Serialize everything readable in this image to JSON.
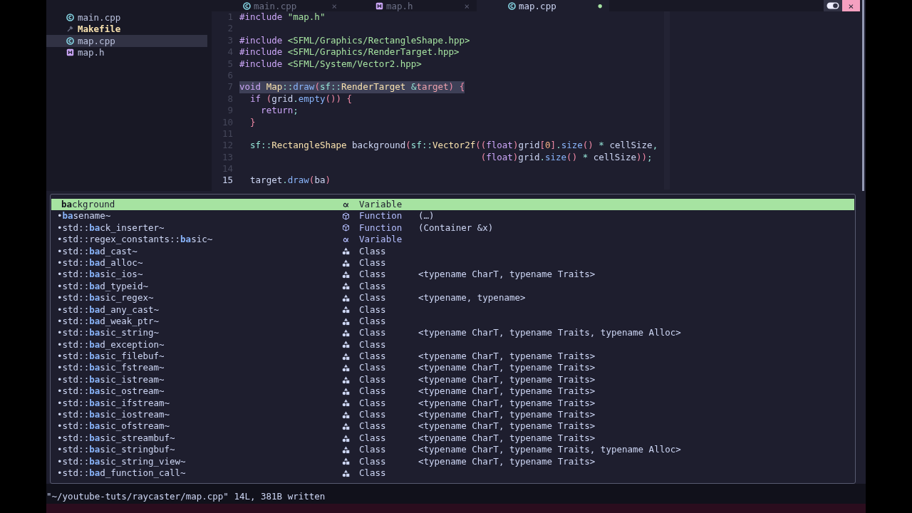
{
  "sidebar": {
    "files": [
      {
        "name": "main.cpp",
        "kind": "cpp",
        "selected": false,
        "modified": false
      },
      {
        "name": "Makefile",
        "kind": "make",
        "selected": false,
        "modified": true
      },
      {
        "name": "map.cpp",
        "kind": "cpp",
        "selected": true,
        "modified": false
      },
      {
        "name": "map.h",
        "kind": "header",
        "selected": false,
        "modified": false
      }
    ]
  },
  "tabs": [
    {
      "label": "main.cpp",
      "kind": "cpp",
      "selected": false,
      "close": "×"
    },
    {
      "label": "map.h",
      "kind": "header",
      "selected": false,
      "close": "×"
    },
    {
      "label": "map.cpp",
      "kind": "cpp",
      "selected": true,
      "close": "●"
    }
  ],
  "window": {
    "close": "×"
  },
  "editor": {
    "lines": [
      {
        "number": "1",
        "current": false,
        "tokens": [
          {
            "kind": "kw",
            "text": "#include"
          },
          {
            "kind": "str",
            "text": " \"map.h\""
          }
        ]
      },
      {
        "number": "2",
        "current": false
      },
      {
        "number": "3",
        "current": false,
        "tokens": [
          {
            "kind": "kw",
            "text": "#include"
          },
          {
            "kind": "str",
            "text": " <SFML/Graphics/RectangleShape.hpp>"
          }
        ]
      },
      {
        "number": "4",
        "current": false,
        "tokens": [
          {
            "kind": "kw",
            "text": "#include"
          },
          {
            "kind": "str",
            "text": " <SFML/Graphics/RenderTarget.hpp>"
          }
        ]
      },
      {
        "number": "5",
        "current": false,
        "tokens": [
          {
            "kind": "kw",
            "text": "#include"
          },
          {
            "kind": "str",
            "text": " <SFML/System/Vector2.hpp>"
          }
        ]
      },
      {
        "number": "6",
        "current": false
      },
      {
        "number": "7",
        "current": false,
        "highlighted": true,
        "tokens": [
          {
            "kind": "kw",
            "text": "void"
          },
          {
            "kind": "type",
            "text": " Map"
          },
          {
            "kind": "op",
            "text": "::"
          },
          {
            "kind": "fn",
            "text": "draw"
          },
          {
            "kind": "punct",
            "text": "("
          },
          {
            "kind": "ns",
            "text": "sf"
          },
          {
            "kind": "op",
            "text": "::"
          },
          {
            "kind": "type",
            "text": "RenderTarget"
          },
          {
            "kind": "op",
            "text": " &"
          },
          {
            "kind": "param",
            "text": "target"
          },
          {
            "kind": "punct",
            "text": ")"
          },
          {
            "kind": "punct",
            "text": " {"
          }
        ]
      },
      {
        "number": "8",
        "current": false,
        "tokens": [
          {
            "kind": "kw",
            "text": "  if"
          },
          {
            "kind": "punct",
            "text": " ("
          },
          {
            "kind": "var",
            "text": "grid"
          },
          {
            "kind": "op",
            "text": "."
          },
          {
            "kind": "fn",
            "text": "empty"
          },
          {
            "kind": "punct",
            "text": "())"
          },
          {
            "kind": "punct",
            "text": " {"
          }
        ]
      },
      {
        "number": "9",
        "current": false,
        "tokens": [
          {
            "kind": "kw",
            "text": "    return"
          },
          {
            "kind": "op",
            "text": ";"
          }
        ]
      },
      {
        "number": "10",
        "current": false,
        "tokens": [
          {
            "kind": "punct",
            "text": "  }"
          }
        ]
      },
      {
        "number": "11",
        "current": false
      },
      {
        "number": "12",
        "current": false,
        "tokens": [
          {
            "kind": "ns",
            "text": "  sf"
          },
          {
            "kind": "op",
            "text": "::"
          },
          {
            "kind": "type",
            "text": "RectangleShape"
          },
          {
            "kind": "var",
            "text": " background"
          },
          {
            "kind": "punct",
            "text": "("
          },
          {
            "kind": "ns",
            "text": "sf"
          },
          {
            "kind": "op",
            "text": "::"
          },
          {
            "kind": "type",
            "text": "Vector2f"
          },
          {
            "kind": "punct",
            "text": "(("
          },
          {
            "kind": "kw",
            "text": "float"
          },
          {
            "kind": "punct",
            "text": ")"
          },
          {
            "kind": "var",
            "text": "grid"
          },
          {
            "kind": "punct",
            "text": "["
          },
          {
            "kind": "num",
            "text": "0"
          },
          {
            "kind": "punct",
            "text": "]"
          },
          {
            "kind": "op",
            "text": "."
          },
          {
            "kind": "fn",
            "text": "size"
          },
          {
            "kind": "punct",
            "text": "()"
          },
          {
            "kind": "op",
            "text": " *"
          },
          {
            "kind": "var",
            "text": " cellSize"
          },
          {
            "kind": "op",
            "text": ","
          }
        ]
      },
      {
        "number": "13",
        "current": false,
        "tokens": [
          {
            "kind": "punct",
            "text": "                                             ("
          },
          {
            "kind": "kw",
            "text": "float"
          },
          {
            "kind": "punct",
            "text": ")"
          },
          {
            "kind": "var",
            "text": "grid"
          },
          {
            "kind": "op",
            "text": "."
          },
          {
            "kind": "fn",
            "text": "size"
          },
          {
            "kind": "punct",
            "text": "()"
          },
          {
            "kind": "op",
            "text": " *"
          },
          {
            "kind": "var",
            "text": " cellSize"
          },
          {
            "kind": "punct",
            "text": "))"
          },
          {
            "kind": "op",
            "text": ";"
          }
        ]
      },
      {
        "number": "14",
        "current": false
      },
      {
        "number": "15",
        "current": true,
        "tokens": [
          {
            "kind": "var",
            "text": "  target"
          },
          {
            "kind": "op",
            "text": "."
          },
          {
            "kind": "fn",
            "text": "draw"
          },
          {
            "kind": "punct",
            "text": "("
          },
          {
            "kind": "var",
            "text": "ba"
          },
          {
            "kind": "punct",
            "text": ")"
          }
        ]
      }
    ]
  },
  "completion": {
    "items": [
      {
        "match": "ba",
        "after": "ckground",
        "kind": "variable",
        "kind_label": "Variable",
        "selected": true
      },
      {
        "before": "•",
        "match": "ba",
        "after": "sename~",
        "kind": "function",
        "kind_label": "Function",
        "detail": "(…)",
        "selected": false
      },
      {
        "before": "•std::",
        "match": "ba",
        "after": "ck_inserter~",
        "kind": "function",
        "kind_label": "Function",
        "detail": "(Container &x)",
        "selected": false
      },
      {
        "before": "•std::regex_constants::",
        "match": "ba",
        "after": "sic~",
        "kind": "variable",
        "kind_label": "Variable",
        "selected": false
      },
      {
        "before": "•std::",
        "match": "ba",
        "after": "d_cast~",
        "kind": "class",
        "kind_label": "Class",
        "selected": false
      },
      {
        "before": "•std::",
        "match": "ba",
        "after": "d_alloc~",
        "kind": "class",
        "kind_label": "Class",
        "selected": false
      },
      {
        "before": "•std::",
        "match": "ba",
        "after": "sic_ios~",
        "kind": "class",
        "kind_label": "Class",
        "detail": "<typename CharT, typename Traits>",
        "selected": false
      },
      {
        "before": "•std::",
        "match": "ba",
        "after": "d_typeid~",
        "kind": "class",
        "kind_label": "Class",
        "selected": false
      },
      {
        "before": "•std::",
        "match": "ba",
        "after": "sic_regex~",
        "kind": "class",
        "kind_label": "Class",
        "detail": "<typename, typename>",
        "selected": false
      },
      {
        "before": "•std::",
        "match": "ba",
        "after": "d_any_cast~",
        "kind": "class",
        "kind_label": "Class",
        "selected": false
      },
      {
        "before": "•std::",
        "match": "ba",
        "after": "d_weak_ptr~",
        "kind": "class",
        "kind_label": "Class",
        "selected": false
      },
      {
        "before": "•std::",
        "match": "ba",
        "after": "sic_string~",
        "kind": "class",
        "kind_label": "Class",
        "detail": "<typename CharT, typename Traits, typename Alloc>",
        "selected": false
      },
      {
        "before": "•std::",
        "match": "ba",
        "after": "d_exception~",
        "kind": "class",
        "kind_label": "Class",
        "selected": false
      },
      {
        "before": "•std::",
        "match": "ba",
        "after": "sic_filebuf~",
        "kind": "class",
        "kind_label": "Class",
        "detail": "<typename CharT, typename Traits>",
        "selected": false
      },
      {
        "before": "•std::",
        "match": "ba",
        "after": "sic_fstream~",
        "kind": "class",
        "kind_label": "Class",
        "detail": "<typename CharT, typename Traits>",
        "selected": false
      },
      {
        "before": "•std::",
        "match": "ba",
        "after": "sic_istream~",
        "kind": "class",
        "kind_label": "Class",
        "detail": "<typename CharT, typename Traits>",
        "selected": false
      },
      {
        "before": "•std::",
        "match": "ba",
        "after": "sic_ostream~",
        "kind": "class",
        "kind_label": "Class",
        "detail": "<typename CharT, typename Traits>",
        "selected": false
      },
      {
        "before": "•std::",
        "match": "ba",
        "after": "sic_ifstream~",
        "kind": "class",
        "kind_label": "Class",
        "detail": "<typename CharT, typename Traits>",
        "selected": false
      },
      {
        "before": "•std::",
        "match": "ba",
        "after": "sic_iostream~",
        "kind": "class",
        "kind_label": "Class",
        "detail": "<typename CharT, typename Traits>",
        "selected": false
      },
      {
        "before": "•std::",
        "match": "ba",
        "after": "sic_ofstream~",
        "kind": "class",
        "kind_label": "Class",
        "detail": "<typename CharT, typename Traits>",
        "selected": false
      },
      {
        "before": "•std::",
        "match": "ba",
        "after": "sic_streambuf~",
        "kind": "class",
        "kind_label": "Class",
        "detail": "<typename CharT, typename Traits>",
        "selected": false
      },
      {
        "before": "•std::",
        "match": "ba",
        "after": "sic_stringbuf~",
        "kind": "class",
        "kind_label": "Class",
        "detail": "<typename CharT, typename Traits, typename Alloc>",
        "selected": false
      },
      {
        "before": "•std::",
        "match": "ba",
        "after": "sic_string_view~",
        "kind": "class",
        "kind_label": "Class",
        "detail": "<typename CharT, typename Traits>",
        "selected": false
      },
      {
        "before": "•std::",
        "match": "ba",
        "after": "d_function_call~",
        "kind": "class",
        "kind_label": "Class",
        "selected": false
      }
    ]
  },
  "status_line": "\"~/youtube-tuts/raycaster/map.cpp\" 14L, 381B written"
}
